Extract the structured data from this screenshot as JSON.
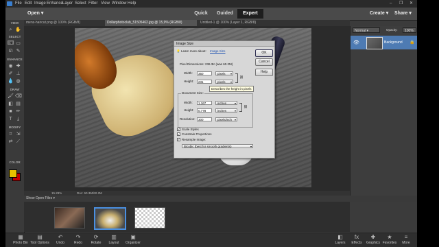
{
  "menubar": {
    "items": [
      "File",
      "Edit",
      "Image",
      "Enhance",
      "Layer",
      "Select",
      "Filter",
      "View",
      "Window",
      "Help"
    ],
    "window_controls": [
      "–",
      "❐",
      "✕"
    ]
  },
  "modebar": {
    "open_label": "Open",
    "modes": [
      "Quick",
      "Guided",
      "Expert"
    ],
    "active_mode": "Expert",
    "create_label": "Create",
    "share_label": "Share"
  },
  "doc_tabs": [
    "mens-haircut.png @ 100% (RGB/8)",
    "Dollarphotoclub_51505462.jpg @ 15,9% (RGB/8)",
    "Untitled-1 @ 100% (Layer 1, RGB/8)"
  ],
  "toolbox": {
    "sections": [
      "VIEW",
      "SELECT",
      "ENHANCE",
      "DRAW",
      "MODIFY",
      "COLOR"
    ]
  },
  "status": {
    "zoom": "15.29%",
    "doc_info": "Doc: 60.3M/60.2M"
  },
  "bin": {
    "dropdown_label": "Show Open Files"
  },
  "layers": {
    "blend_mode": "Normal",
    "opacity_label": "Opacity:",
    "opacity_value": "100%",
    "layer_name": "Background"
  },
  "bottombar": {
    "left": [
      "Photo Bin",
      "Tool Options",
      "Undo",
      "Redo",
      "Rotate",
      "Layout",
      "Organizer"
    ],
    "right": [
      "Layers",
      "Effects",
      "Graphics",
      "Favorites",
      "More"
    ]
  },
  "dialog": {
    "title": "Image Size",
    "learn_more_prefix": "Learn more about:",
    "learn_more_link": "Image Size",
    "ok_label": "OK",
    "cancel_label": "Cancel",
    "help_label": "Help",
    "pixel_dimensions": "Pixel Dimensions: 236.3K (was 60.2M)",
    "width_label": "Width:",
    "width_value": "350",
    "width_unit": "pixels",
    "height_label": "Height:",
    "height_value": "231",
    "height_unit": "pixels",
    "document_size": "Document Size:",
    "doc_width_label": "Width:",
    "doc_width_value": "1.167",
    "doc_width_unit": "inches",
    "doc_height_label": "Height:",
    "doc_height_value": "0.778",
    "doc_height_unit": "inches",
    "resolution_label": "Resolution:",
    "resolution_value": "300",
    "resolution_unit": "pixels/inch",
    "scale_styles": "Scale Styles",
    "constrain_proportions": "Constrain Proportions",
    "resample_image": "Resample Image:",
    "resample_method": "Bicubic (best for smooth gradients)",
    "tooltip": "Describes the height in pixels"
  },
  "colors": {
    "accent": "#4a90e2",
    "foreground": "#e6c200",
    "background": "#c00000"
  }
}
